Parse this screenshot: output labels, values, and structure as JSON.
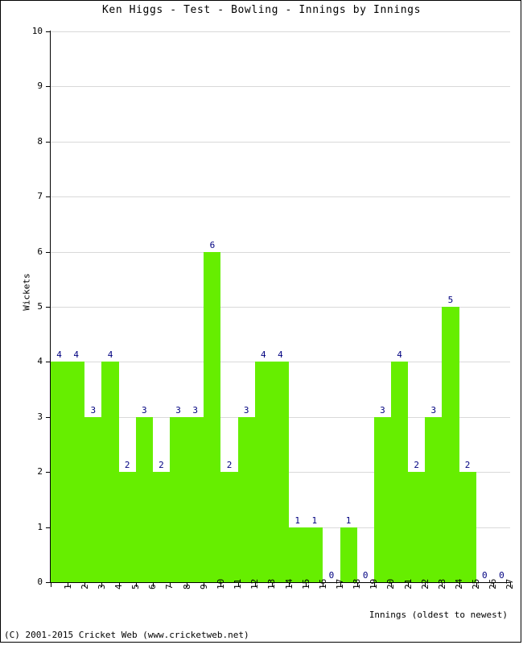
{
  "chart_data": {
    "type": "bar",
    "title": "Ken Higgs - Test - Bowling - Innings by Innings",
    "xlabel": "Innings (oldest to newest)",
    "ylabel": "Wickets",
    "ylim": [
      0,
      10
    ],
    "yticks": [
      0,
      1,
      2,
      3,
      4,
      5,
      6,
      7,
      8,
      9,
      10
    ],
    "ytick_labels": [
      "0",
      "1",
      "2",
      "3",
      "4",
      "5",
      "6",
      "7",
      "8",
      "9",
      "10"
    ],
    "grid": true,
    "legend": null,
    "bar_color": "#66ee00",
    "label_color": "#000080",
    "categories": [
      "1",
      "2",
      "3",
      "4",
      "5",
      "6",
      "7",
      "8",
      "9",
      "10",
      "11",
      "12",
      "13",
      "14",
      "15",
      "16",
      "17",
      "18",
      "19",
      "20",
      "21",
      "22",
      "23",
      "24",
      "25",
      "26",
      "27"
    ],
    "values": [
      4,
      4,
      3,
      4,
      2,
      3,
      2,
      3,
      3,
      6,
      2,
      3,
      4,
      4,
      1,
      1,
      0,
      1,
      0,
      3,
      4,
      2,
      3,
      5,
      2,
      0,
      0
    ],
    "data_labels": [
      "4",
      "4",
      "3",
      "4",
      "2",
      "3",
      "2",
      "3",
      "3",
      "6",
      "2",
      "3",
      "4",
      "4",
      "1",
      "1",
      "0",
      "1",
      "0",
      "3",
      "4",
      "2",
      "3",
      "5",
      "2",
      "0",
      "0"
    ]
  },
  "footer": {
    "copyright": "(C) 2001-2015 Cricket Web (www.cricketweb.net)"
  }
}
